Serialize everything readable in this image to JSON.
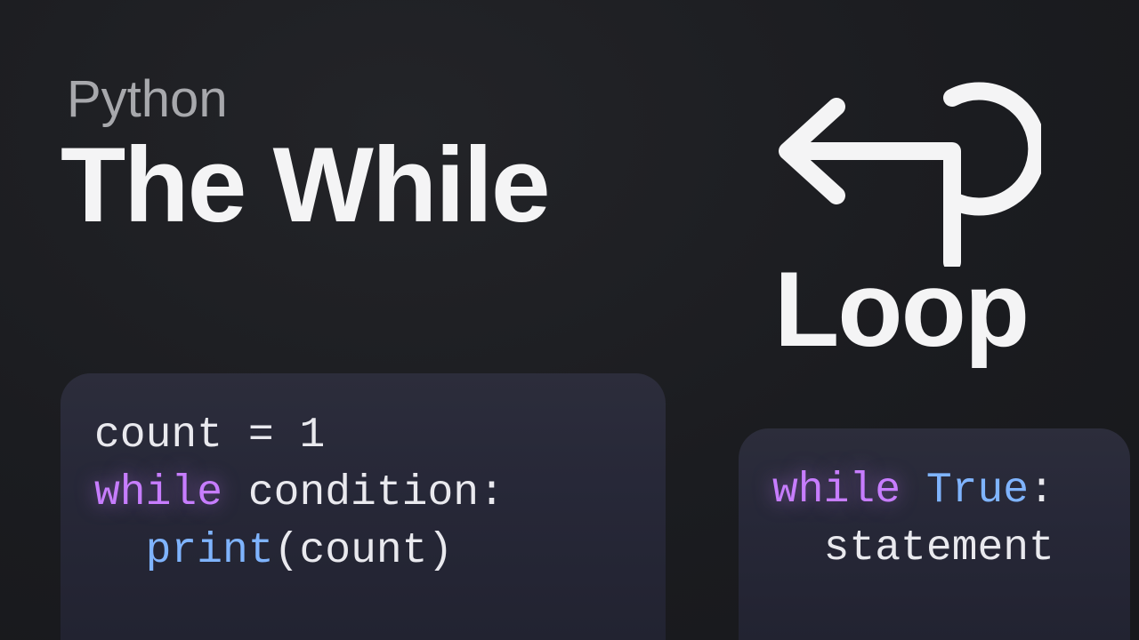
{
  "header": {
    "subtitle": "Python",
    "title_part1": "The While",
    "title_part2": "Loop"
  },
  "code_left": {
    "line1_var": "count",
    "line1_eq": " = ",
    "line1_val": "1",
    "line2_kw": "while",
    "line2_cond": " condition",
    "line2_colon": ":",
    "line3_fn": "print",
    "line3_open": "(",
    "line3_arg": "count",
    "line3_close": ")"
  },
  "code_right": {
    "line1_kw": "while",
    "line1_sp": " ",
    "line1_bool": "True",
    "line1_colon": ":",
    "line2_stmt": "statement"
  },
  "icon": {
    "name": "loop-arrow"
  },
  "colors": {
    "bg": "#1c1d21",
    "panel": "#272838",
    "text": "#e9e9ee",
    "muted": "#a7a8ac",
    "keyword": "#c77dff",
    "builtin": "#7fb4ff"
  }
}
